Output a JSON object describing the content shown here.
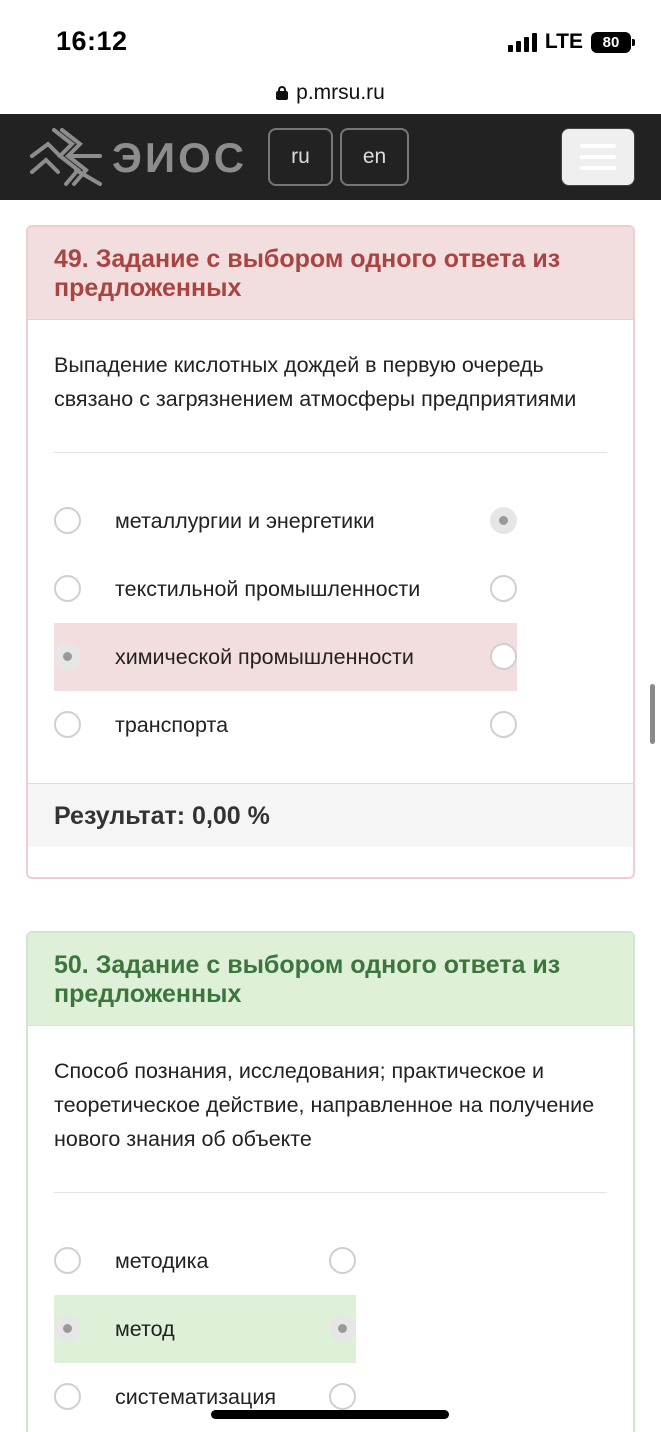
{
  "status_bar": {
    "time": "16:12",
    "network": "LTE",
    "battery": "80"
  },
  "browser": {
    "url": "p.mrsu.ru"
  },
  "site": {
    "brand": "ЭИОС",
    "lang_ru": "ru",
    "lang_en": "en"
  },
  "questions": [
    {
      "title": "49. Задание с выбором одного ответа из предложенных",
      "text": "Выпадение кислотных дождей в первую очередь связано с загрязнением атмосферы предприятиями",
      "options": [
        {
          "label": "металлургии и энергетики",
          "selected": false,
          "correct": true
        },
        {
          "label": "текстильной промышленности",
          "selected": false,
          "correct": false
        },
        {
          "label": "химической промышленности",
          "selected": true,
          "correct": false
        },
        {
          "label": "транспорта",
          "selected": false,
          "correct": false
        }
      ],
      "result": "Результат: 0,00 %"
    },
    {
      "title": "50. Задание с выбором одного ответа из предложенных",
      "text": "Способ познания, исследования; практическое и теоретическое действие, направленное на получение нового знания об объекте",
      "options": [
        {
          "label": "методика",
          "selected": false,
          "correct": false
        },
        {
          "label": "метод",
          "selected": true,
          "correct": true
        },
        {
          "label": "систематизация",
          "selected": false,
          "correct": false
        }
      ]
    }
  ],
  "colors": {
    "header_bg": "#222222",
    "wrong_bg": "#f2dede",
    "wrong_text": "#a94442",
    "right_bg": "#dff0d8",
    "right_text": "#3c763d"
  }
}
